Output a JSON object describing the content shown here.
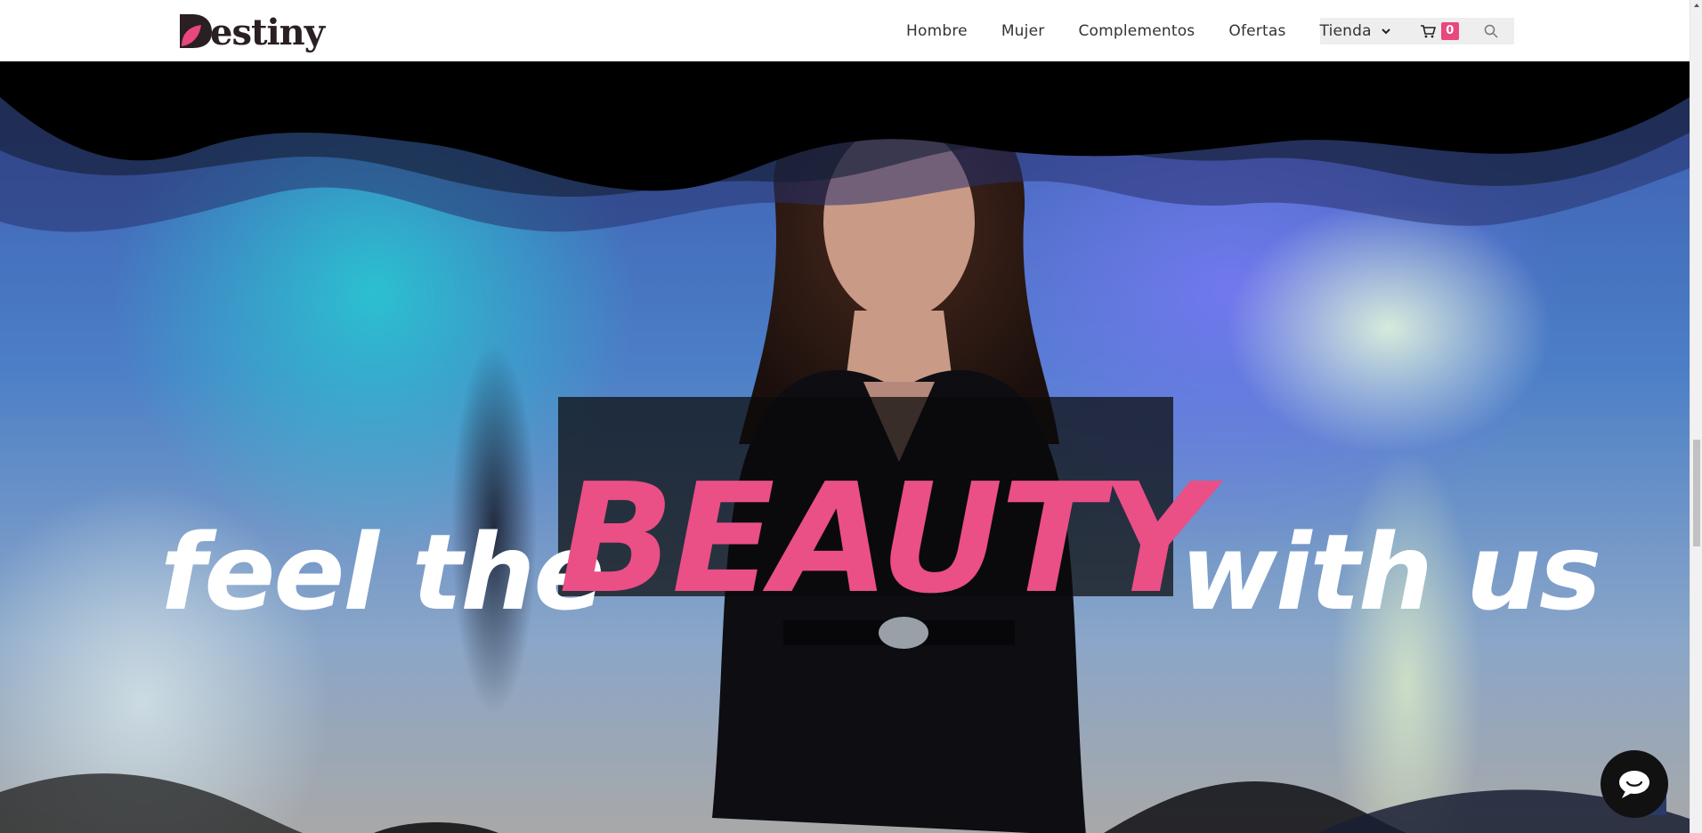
{
  "brand": {
    "name": "Destiny",
    "logo_text": "estiny",
    "accent_color": "#e8487c"
  },
  "nav": {
    "items": [
      "Hombre",
      "Mujer",
      "Complementos",
      "Ofertas"
    ],
    "shop_label": "Tienda",
    "cart_count": "0"
  },
  "hero": {
    "headline_part1": "feel the",
    "headline_highlight": "BEAUTY",
    "headline_part2": "with us",
    "highlight_color": "#ea4f86"
  },
  "icons": {
    "shop_dropdown": "chevron-down-icon",
    "cart": "cart-icon",
    "search": "search-icon",
    "chat": "chat-icon",
    "scroll_up": "arrow-up-icon"
  }
}
